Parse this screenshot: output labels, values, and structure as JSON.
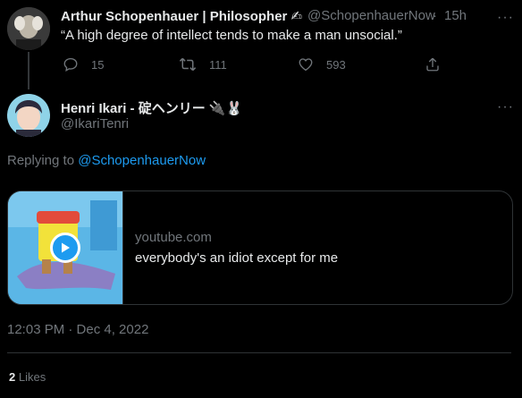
{
  "parent_tweet": {
    "display_name": "Arthur Schopenhauer | Philosopher ✍",
    "handle": "@SchopenhauerNow",
    "separator": "·",
    "time": "15h",
    "text": "“A high degree of intellect tends to make a man unsocial.”",
    "replies": "15",
    "retweets": "111",
    "likes": "593"
  },
  "reply_tweet": {
    "display_name": "Henri Ikari - 碇ヘンリー 🔌🐰",
    "handle": "@IkariTenri",
    "replying_prefix": "Replying to",
    "replying_handle": "@SchopenhauerNow",
    "card": {
      "domain": "youtube.com",
      "title": "everybody's an idiot except for me"
    },
    "timestamp": "12:03 PM · Dec 4, 2022",
    "likes_count": "2",
    "likes_label": "Likes"
  },
  "icons": [
    "more-icon",
    "reply-icon",
    "retweet-icon",
    "like-icon",
    "share-icon",
    "play-icon"
  ],
  "colors": {
    "background": "#000000",
    "text": "#e7e9ea",
    "muted": "#71767b",
    "accent": "#1d9bf0",
    "border": "#2f3336"
  }
}
